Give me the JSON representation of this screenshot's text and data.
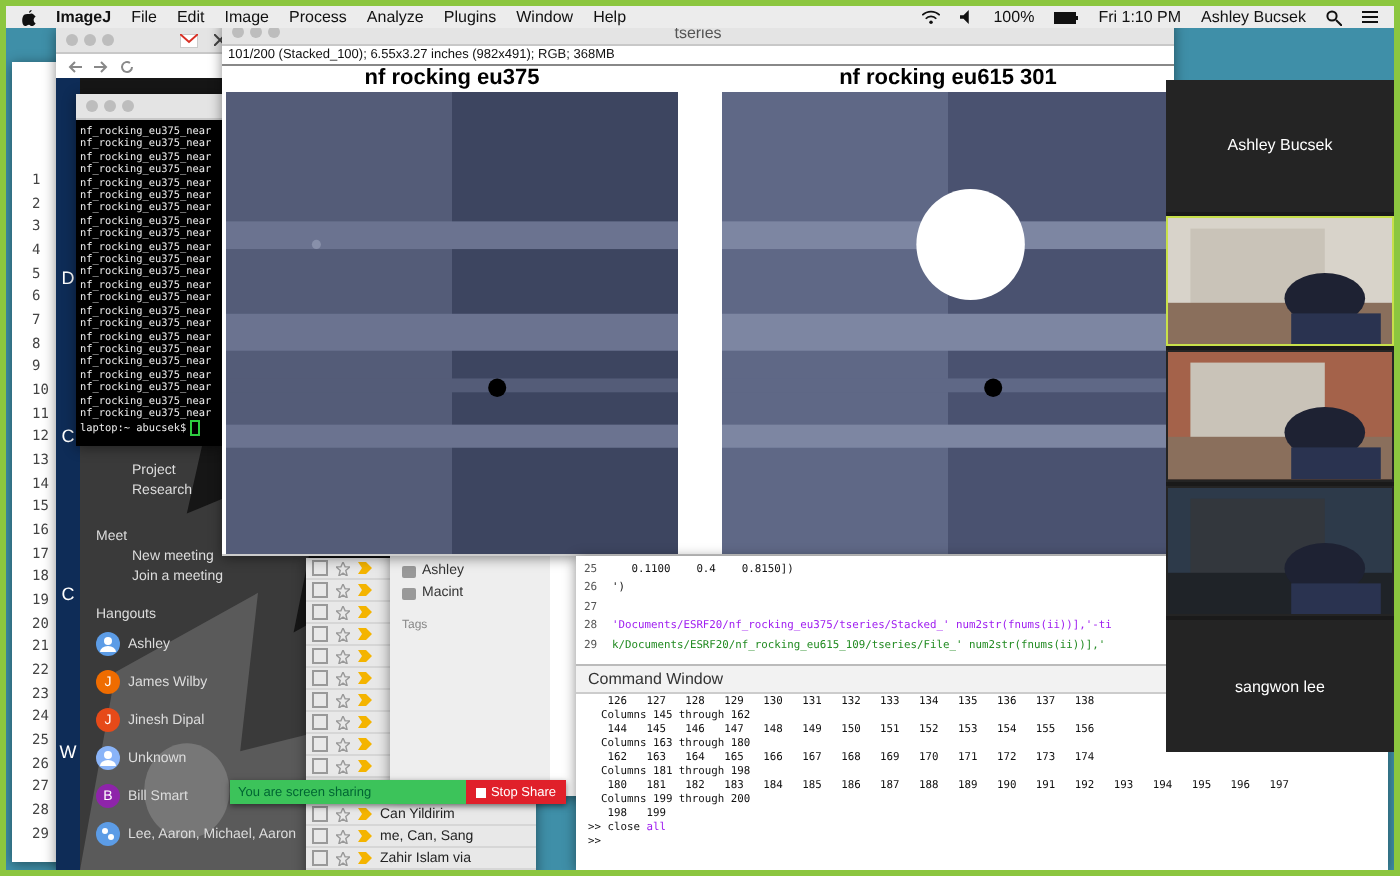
{
  "menubar": {
    "app": "ImageJ",
    "menus": [
      "File",
      "Edit",
      "Image",
      "Process",
      "Analyze",
      "Plugins",
      "Window",
      "Help"
    ],
    "battery": "100%",
    "clock": "Fri 1:10 PM",
    "user": "Ashley Bucsek"
  },
  "editor_gutter": [
    "1",
    "2",
    "3",
    "4",
    "5",
    "6",
    "7",
    "8",
    "9",
    "10",
    "11",
    "12",
    "13",
    "14",
    "15",
    "16",
    "17",
    "18",
    "19",
    "20",
    "21",
    "22",
    "23",
    "24",
    "25",
    "26",
    "27",
    "28",
    "29"
  ],
  "gmail": {
    "sidebar_letters": [
      "D",
      "C",
      "C",
      "W"
    ],
    "nav": [
      "Project",
      "Research"
    ],
    "meet_heading": "Meet",
    "meet_items": [
      "New meeting",
      "Join a meeting"
    ],
    "hangouts_heading": "Hangouts",
    "contacts": [
      {
        "name": "Ashley",
        "kind": "silhouette",
        "color": "#5c9ce6"
      },
      {
        "name": "James Wilby",
        "kind": "initial",
        "initial": "J",
        "color": "#ef6c00"
      },
      {
        "name": "Jinesh Dipal",
        "kind": "initial",
        "initial": "J",
        "color": "#e64a19"
      },
      {
        "name": "Unknown",
        "kind": "silhouette",
        "color": "#8ab4f8"
      },
      {
        "name": "Bill Smart",
        "kind": "initial",
        "initial": "B",
        "color": "#8e24aa"
      },
      {
        "name": "Lee, Aaron, Michael, Aaron",
        "kind": "group",
        "color": "#5c9ce6"
      }
    ],
    "mail_rows": [
      {
        "checked": false
      },
      {
        "checked": false
      },
      {
        "checked": false
      },
      {
        "checked": false
      },
      {
        "checked": false
      },
      {
        "checked": false
      },
      {
        "checked": false
      },
      {
        "checked": false
      },
      {
        "checked": false
      },
      {
        "checked": false
      },
      {
        "checked": false,
        "sender": "Can Yildirim"
      },
      {
        "checked": false,
        "sender": "me, Can, Sang"
      },
      {
        "checked": false,
        "sender": "Zahir Islam via"
      }
    ]
  },
  "terminal": {
    "lines": [
      "nf_rocking_eu375_near",
      "nf_rocking_eu375_near",
      "nf_rocking_eu375_near",
      "nf_rocking_eu375_near",
      "nf_rocking_eu375_near",
      "nf_rocking_eu375_near",
      "nf_rocking_eu375_near",
      "nf_rocking_eu375_near",
      "nf_rocking_eu375_near",
      "nf_rocking_eu375_near",
      "nf_rocking_eu375_near",
      "nf_rocking_eu375_near",
      "nf_rocking_eu375_near",
      "nf_rocking_eu375_near",
      "nf_rocking_eu375_near",
      "nf_rocking_eu375_near",
      "nf_rocking_eu375_near",
      "nf_rocking_eu375_near",
      "nf_rocking_eu375_near",
      "nf_rocking_eu375_near",
      "nf_rocking_eu375_near",
      "nf_rocking_eu375_near",
      "nf_rocking_eu375_near"
    ],
    "prompt": "laptop:~ abucsek$"
  },
  "tseries": {
    "title": "tseries",
    "info": "101/200 (Stacked_100); 6.55x3.27 inches (982x491); RGB; 368MB",
    "panels": [
      {
        "title": "nf rocking eu375",
        "kind": "dim"
      },
      {
        "title": "nf rocking eu615 301",
        "kind": "bright"
      }
    ]
  },
  "finder": {
    "items": [
      "Ashley",
      "Macint"
    ],
    "tags": "Tags"
  },
  "matlab": {
    "editor": [
      {
        "number": "25",
        "text": "   0.1100    0.4    0.8150])",
        "kind": "plain"
      },
      {
        "number": "26",
        "text": "')",
        "kind": "plain"
      },
      {
        "number": "27"
      },
      {
        "number": "28",
        "text": "'Documents/ESRF20/nf_rocking_eu375/tseries/Stacked_' num2str(fnums(ii))],'-ti",
        "kind": "string"
      },
      {
        "number": "29",
        "text": "k/Documents/ESRF20/nf_rocking_eu615_109/tseries/File_' num2str(fnums(ii))],'",
        "kind": "comment"
      }
    ],
    "command_title": "Command Window",
    "output": [
      "   126   127   128   129   130   131   132   133   134   135   136   137   138",
      "  Columns 145 through 162",
      "   144   145   146   147   148   149   150   151   152   153   154   155   156",
      "  Columns 163 through 180",
      "   162   163   164   165   166   167   168   169   170   171   172   173   174",
      "  Columns 181 through 198",
      "   180   181   182   183   184   185   186   187   188   189   190   191   192   193   194   195   196   197",
      "  Columns 199 through 200",
      "   198   199"
    ],
    "command": {
      "prompt": ">>",
      "verb": "close",
      "arg": "all"
    },
    "prompt": ">>"
  },
  "share_bar": {
    "text": "You are screen sharing",
    "stop": "Stop Share"
  },
  "zoom_tiles": [
    {
      "kind": "name",
      "name": "Ashley Bucsek",
      "active": false
    },
    {
      "kind": "video",
      "active": true
    },
    {
      "kind": "video",
      "active": false
    },
    {
      "kind": "video",
      "active": false
    },
    {
      "kind": "name",
      "name": "sangwon lee",
      "active": false
    }
  ]
}
